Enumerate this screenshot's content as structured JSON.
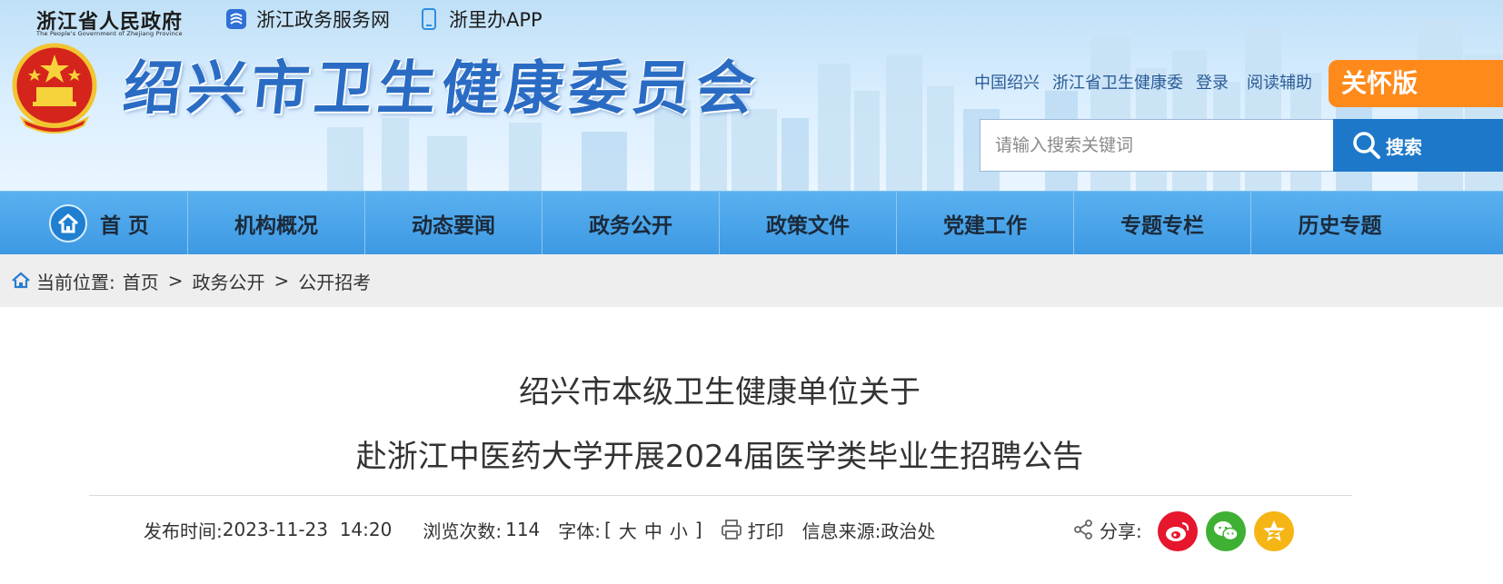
{
  "topbar": {
    "gov_name": "浙江省人民政府",
    "gov_sub": "The People's Government of Zhejiang Province",
    "link1": "浙江政务服务网",
    "link2": "浙里办APP"
  },
  "site": {
    "title": "绍兴市卫生健康委员会",
    "util_links": [
      "中国绍兴",
      "浙江省卫生健康委",
      "登录",
      "阅读辅助"
    ],
    "care_mode": "关怀版"
  },
  "search": {
    "placeholder": "请输入搜索关键词",
    "button": "搜索"
  },
  "nav": {
    "items": [
      "首 页",
      "机构概况",
      "动态要闻",
      "政务公开",
      "政策文件",
      "党建工作",
      "专题专栏",
      "历史专题"
    ]
  },
  "breadcrumb": {
    "label": "当前位置:",
    "items": [
      "首页",
      "政务公开",
      "公开招考"
    ],
    "sep": ">"
  },
  "article": {
    "title_line1": "绍兴市本级卫生健康单位关于",
    "title_line2": "赴浙江中医药大学开展2024届医学类毕业生招聘公告",
    "publish_label": "发布时间:",
    "publish_time": "2023-11-23  14:20",
    "views_label": "浏览次数:",
    "views": "114",
    "font_label": "字体:",
    "font_open": "[",
    "font_large": "大",
    "font_medium": "中",
    "font_small": "小",
    "font_close": "]",
    "print": "打印",
    "source_label": "信息来源:",
    "source": "政治处",
    "share_label": "分享:"
  },
  "colors": {
    "nav_bg": "#4aa6ea",
    "title_blue": "#2a6cc4",
    "care_orange": "#ff8a1c",
    "search_blue": "#1d78c9",
    "weibo": "#e6162d",
    "wechat": "#3eb135",
    "qzone": "#f5b515"
  }
}
